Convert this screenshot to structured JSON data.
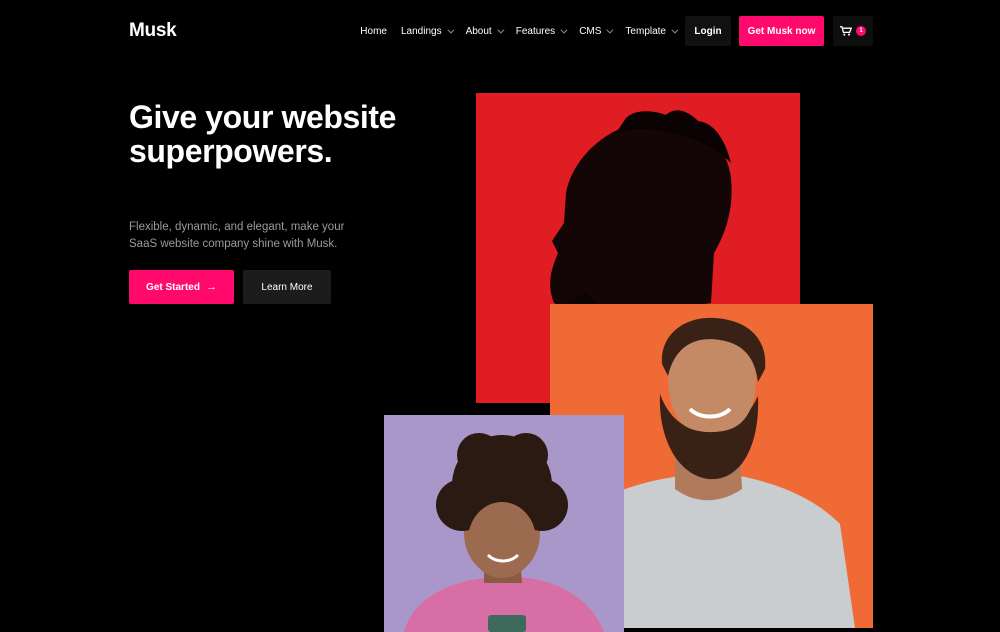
{
  "brand": {
    "logo": "Musk",
    "accent_color": "#ff0a6c"
  },
  "nav": {
    "items": [
      {
        "label": "Home",
        "has_dropdown": false
      },
      {
        "label": "Landings",
        "has_dropdown": true
      },
      {
        "label": "About",
        "has_dropdown": true
      },
      {
        "label": "Features",
        "has_dropdown": true
      },
      {
        "label": "CMS",
        "has_dropdown": true
      },
      {
        "label": "Template",
        "has_dropdown": true
      }
    ],
    "login_label": "Login",
    "cta_label": "Get Musk now",
    "cart_icon": "cart-icon",
    "cart_count": "1"
  },
  "hero": {
    "title": "Give your website superpowers.",
    "subtitle": "Flexible, dynamic, and elegant, make your SaaS website company shine with Musk.",
    "primary_button": "Get Started",
    "primary_button_icon": "arrow-right-icon",
    "secondary_button": "Learn More"
  },
  "images": [
    {
      "name": "portrait-red",
      "bg": "#e01d22"
    },
    {
      "name": "portrait-orange",
      "bg": "#ef6a35"
    },
    {
      "name": "portrait-purple",
      "bg": "#a997c9"
    }
  ]
}
